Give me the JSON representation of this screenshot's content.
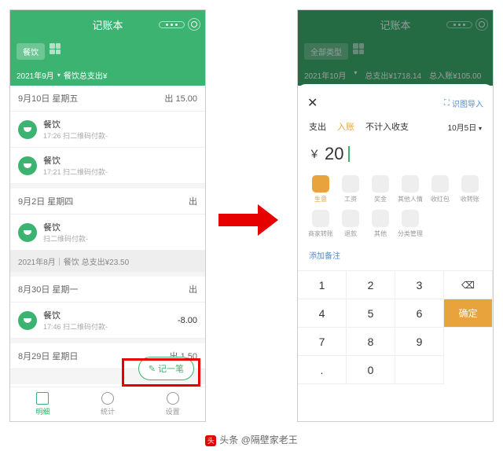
{
  "leftPhone": {
    "title": "记账本",
    "filterChip": "餐饮",
    "subLine": {
      "month": "2021年9月",
      "text": "餐饮总支出¥"
    },
    "days": [
      {
        "date": "9月10日 星期五",
        "out": "出 15.00",
        "items": [
          {
            "name": "餐饮",
            "time": "17:26",
            "note": "扫二维码付款-",
            "amt": ""
          },
          {
            "name": "餐饮",
            "time": "17:21",
            "note": "扫二维码付款-",
            "amt": ""
          }
        ]
      },
      {
        "date": "9月2日 星期四",
        "out": "出",
        "items": [
          {
            "name": "餐饮",
            "time": "",
            "note": "扫二维码付款-",
            "amt": ""
          }
        ]
      }
    ],
    "monthBar": "2021年8月｜餐饮 总支出¥23.50",
    "day3": {
      "date": "8月30日 星期一",
      "out": "出",
      "items": [
        {
          "name": "餐饮",
          "time": "17:46",
          "note": "扫二维码付款-",
          "amt": "-8.00"
        }
      ]
    },
    "day4": {
      "date": "8月29日 星期日",
      "out": "出 1.50"
    },
    "fabLabel": "记一笔",
    "tabs": [
      "明细",
      "统计",
      "设置"
    ]
  },
  "rightPhone": {
    "title": "记账本",
    "filterChip": "全部类型",
    "subLine": {
      "month": "2021年10月",
      "out": "总支出¥1718.14",
      "in": "总入账¥105.00"
    },
    "sheet": {
      "importLabel": "识图导入",
      "tabs": [
        "支出",
        "入账",
        "不计入收支"
      ],
      "activeTab": 1,
      "date": "10月5日",
      "currency": "￥",
      "amount": "20",
      "cats": [
        "生意",
        "工资",
        "奖金",
        "其他人情",
        "收红包",
        "收转账",
        "商家转账",
        "退款",
        "其他",
        "分类管理"
      ],
      "memo": "添加备注",
      "keys": [
        "1",
        "2",
        "3",
        "bs",
        "4",
        "5",
        "6",
        "ok",
        "7",
        "8",
        "9",
        ".",
        "0",
        ""
      ],
      "okLabel": "确定"
    }
  },
  "caption": {
    "prefix": "头条",
    "text": "@隔壁家老王"
  }
}
